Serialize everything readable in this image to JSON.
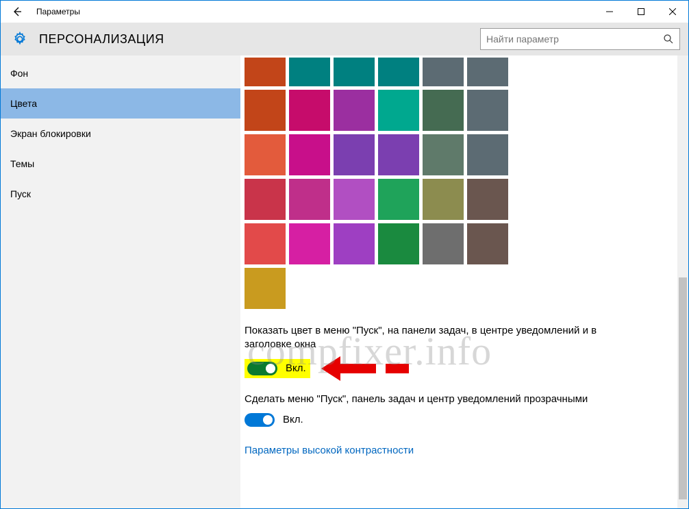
{
  "window": {
    "title": "Параметры"
  },
  "header": {
    "title": "ПЕРСОНАЛИЗАЦИЯ"
  },
  "search": {
    "placeholder": "Найти параметр"
  },
  "sidebar": {
    "items": [
      {
        "label": "Фон"
      },
      {
        "label": "Цвета"
      },
      {
        "label": "Экран блокировки"
      },
      {
        "label": "Темы"
      },
      {
        "label": "Пуск"
      }
    ]
  },
  "colors": {
    "rows": [
      [
        "#c24519",
        "#008080",
        "#008080",
        "#008080",
        "#5c6b73",
        "#5c6b73"
      ],
      [
        "#c24519",
        "#c60c6b",
        "#9b2fa0",
        "#00a88f",
        "#456b52",
        "#5c6b73"
      ],
      [
        "#e35b3c",
        "#c80f8a",
        "#7b3fb0",
        "#7b3fb0",
        "#5f7a6a",
        "#5c6b73"
      ],
      [
        "#c9344a",
        "#bf2f8a",
        "#b14fc2",
        "#1fa35a",
        "#8c8c4f",
        "#6a564f"
      ],
      [
        "#e24a4a",
        "#d61fa3",
        "#9e3fc2",
        "#1a8a3f",
        "#6e6e6e",
        "#6a564f"
      ]
    ],
    "extra": "#c99b1f"
  },
  "settings": {
    "showColor": {
      "label": "Показать цвет в меню \"Пуск\", на панели задач, в центре уведомлений и в заголовке окна",
      "state": "Вкл."
    },
    "transparency": {
      "label": "Сделать меню \"Пуск\", панель задач и центр уведомлений прозрачными",
      "state": "Вкл."
    },
    "highContrastLink": "Параметры высокой контрастности"
  },
  "watermark": "compfixer.info"
}
